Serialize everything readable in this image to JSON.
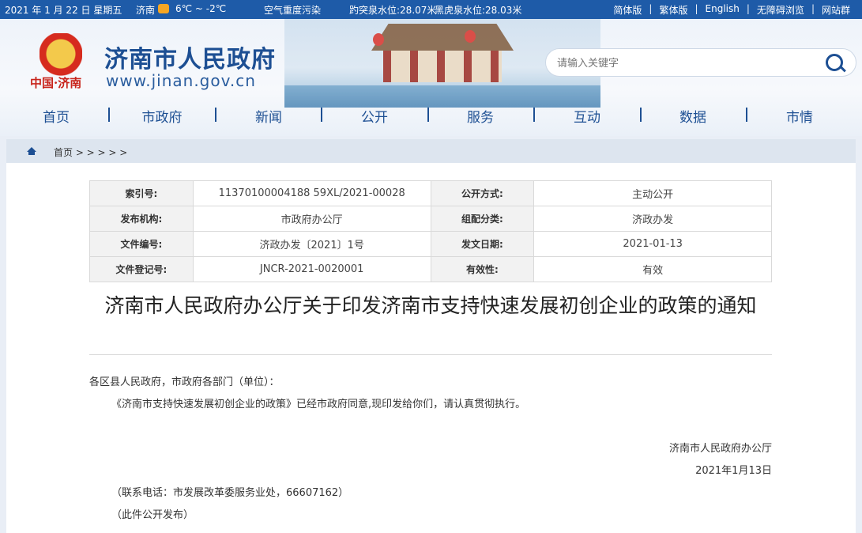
{
  "topbar": {
    "date": "2021 年 1 月 22 日 星期五",
    "city": "济南",
    "weather_icon": "partly-cloudy-icon",
    "temperature": "6℃ ~ -2℃",
    "air_quality": "空气重度污染",
    "spring1": "趵突泉水位:28.07米",
    "spring2": "黑虎泉水位:28.03米",
    "links": [
      "简体版",
      "繁体版",
      "English",
      "无障碍浏览",
      "网站群"
    ]
  },
  "header": {
    "emblem_caption": "中国·济南",
    "site_title": "济南市人民政府",
    "site_url": "www.jinan.gov.cn",
    "search_placeholder": "请输入关键字"
  },
  "nav": {
    "items": [
      "首页",
      "市政府",
      "新闻",
      "公开",
      "服务",
      "互动",
      "数据",
      "市情"
    ]
  },
  "breadcrumb": {
    "text": "首页 > > > > >"
  },
  "meta": {
    "rows": [
      {
        "k1": "索引号:",
        "v1": "11370100004188 59XL/2021-00028",
        "k2": "公开方式:",
        "v2": "主动公开"
      },
      {
        "k1": "发布机构:",
        "v1": "市政府办公厅",
        "k2": "组配分类:",
        "v2": "济政办发"
      },
      {
        "k1": "文件编号:",
        "v1": "济政办发〔2021〕1号",
        "k2": "发文日期:",
        "v2": "2021-01-13"
      },
      {
        "k1": "文件登记号:",
        "v1": "JNCR-2021-0020001",
        "k2": "有效性:",
        "v2": "有效"
      }
    ]
  },
  "document": {
    "title": "济南市人民政府办公厅关于印发济南市支持快速发展初创企业的政策的通知",
    "salutation": "各区县人民政府，市政府各部门（单位）：",
    "body": "《济南市支持快速发展初创企业的政策》已经市政府同意,现印发给你们，请认真贯彻执行。",
    "signer": "济南市人民政府办公厅",
    "date": "2021年1月13日",
    "contact": "（联系电话：市发展改革委服务业处，66607162）",
    "publish_note": "（此件公开发布）"
  }
}
